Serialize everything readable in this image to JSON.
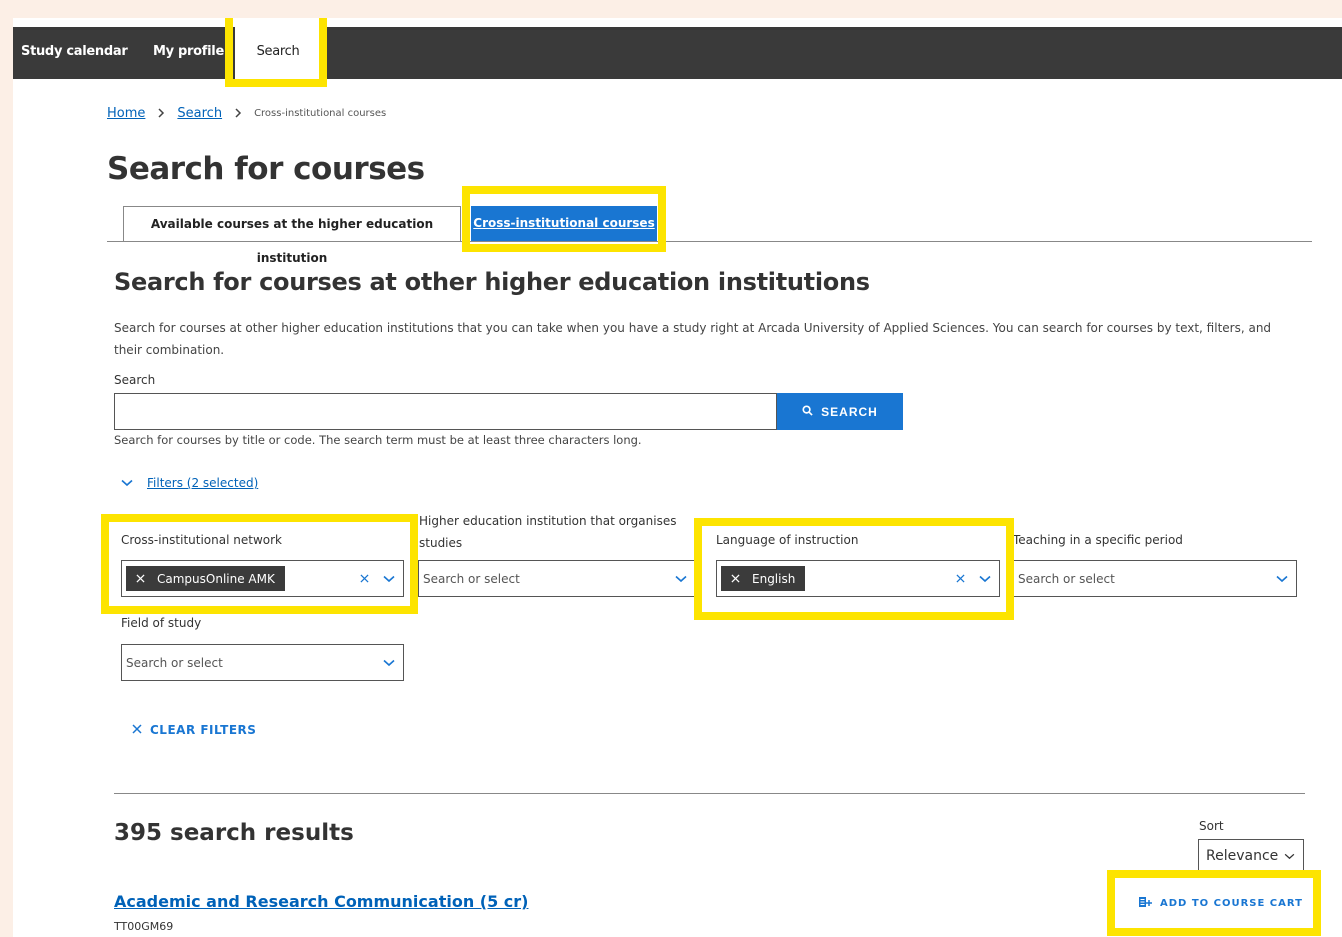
{
  "nav": {
    "items": [
      {
        "label": "Study calendar"
      },
      {
        "label": "My profile"
      },
      {
        "label": "Search"
      }
    ]
  },
  "breadcrumb": {
    "home": "Home",
    "search": "Search",
    "current": "Cross-institutional courses"
  },
  "page": {
    "title": "Search for courses"
  },
  "tabs": [
    {
      "label": "Available courses at the higher education institution"
    },
    {
      "label": "Cross-institutional courses"
    }
  ],
  "section": {
    "title": "Search for courses at other higher education institutions",
    "description": "Search for courses at other higher education institutions that you can take when you have a study right at Arcada University of Applied Sciences. You can search for courses by text, filters, and their combination."
  },
  "search": {
    "label": "Search",
    "value": "",
    "button_label": "SEARCH",
    "hint": "Search for courses by title or code. The search term must be at least three characters long."
  },
  "filters": {
    "toggle_label": "Filters (2 selected)",
    "network": {
      "label": "Cross-institutional network",
      "chip": "CampusOnline AMK"
    },
    "organiser": {
      "label": "Higher education institution that organises studies",
      "placeholder": "Search or select"
    },
    "language": {
      "label": "Language of instruction",
      "chip": "English"
    },
    "period": {
      "label": "Teaching in a specific period",
      "placeholder": "Search or select"
    },
    "field": {
      "label": "Field of study",
      "placeholder": "Search or select"
    },
    "clear_label": "CLEAR FILTERS"
  },
  "results": {
    "count_label": "395 search results",
    "sort_label": "Sort",
    "sort_value": "Relevance",
    "items": [
      {
        "title": "Academic and Research Communication (5 cr)",
        "code": "TT00GM69",
        "cart_label": "ADD TO COURSE CART"
      }
    ]
  },
  "colors": {
    "accent": "#1976d2",
    "highlight": "#fde400",
    "nav_bg": "#3a3a3a"
  }
}
